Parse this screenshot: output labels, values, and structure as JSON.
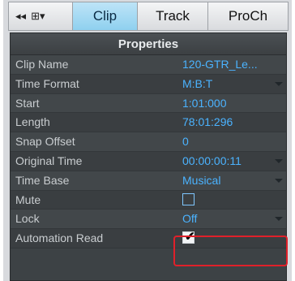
{
  "tabs": {
    "icons_back": "◂◂",
    "icons_split": "⊞▾",
    "clip": "Clip",
    "track": "Track",
    "proch": "ProCh"
  },
  "properties": {
    "header": "Properties",
    "rows": [
      {
        "label": "Clip Name",
        "value": "120-GTR_Le..."
      },
      {
        "label": "Time Format",
        "value": "M:B:T"
      },
      {
        "label": "Start",
        "value": "1:01:000"
      },
      {
        "label": "Length",
        "value": "78:01:296"
      },
      {
        "label": "Snap Offset",
        "value": "0"
      },
      {
        "label": "Original Time",
        "value": "00:00:00:11"
      },
      {
        "label": "Time Base",
        "value": "Musical"
      },
      {
        "label": "Mute",
        "value": ""
      },
      {
        "label": "Lock",
        "value": "Off"
      },
      {
        "label": "Automation Read",
        "value": ""
      }
    ]
  },
  "checkmark": "✔",
  "colors": {
    "accent": "#4bb3ff",
    "highlight": "#e0202a",
    "active_tab": "#8fd0ef"
  }
}
